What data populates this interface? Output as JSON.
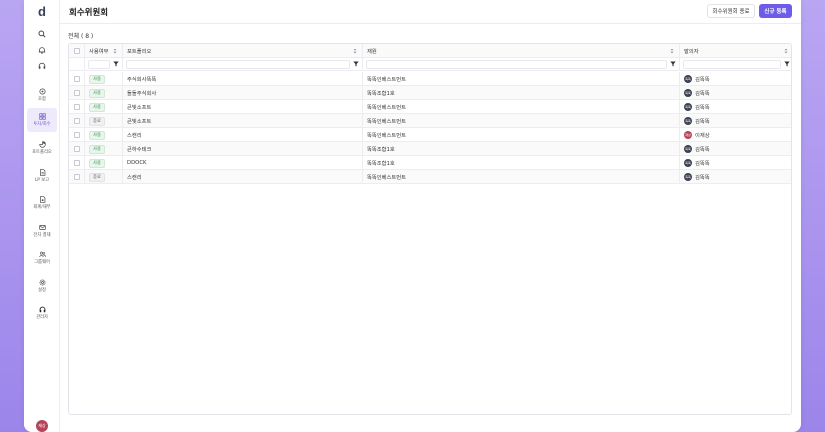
{
  "app": {
    "logo_text": "d",
    "title": "회수위원회",
    "colors": {
      "accent": "#6c5ce7",
      "active_nav_bg": "#eeeafc",
      "badge_green": "#3b8a50"
    }
  },
  "sidebar": {
    "top_icons": [
      "search-icon",
      "bell-icon",
      "headset-icon"
    ],
    "items": [
      {
        "label": "조합",
        "icon": "fund-icon",
        "active": false
      },
      {
        "label": "투자/회수",
        "icon": "grid-icon",
        "active": true
      },
      {
        "label": "포트폴리오",
        "icon": "pie-icon",
        "active": false
      },
      {
        "label": "LP 보고",
        "icon": "document-icon",
        "active": false
      },
      {
        "label": "회계/재무",
        "icon": "ledger-icon",
        "active": false
      },
      {
        "label": "전자 결재",
        "icon": "mail-icon",
        "active": false
      },
      {
        "label": "그룹웨어",
        "icon": "users-icon",
        "active": false
      },
      {
        "label": "설정",
        "icon": "gear-icon",
        "active": false
      },
      {
        "label": "관리자",
        "icon": "admin-icon",
        "active": false
      }
    ],
    "user_initials": "재상"
  },
  "header": {
    "close_button": "회수위원회 종료",
    "new_button": "신규 등록"
  },
  "total_label": "전체 ( 8 )",
  "table": {
    "columns": [
      "사용여부",
      "포트폴리오",
      "재원",
      "발의자"
    ],
    "rows": [
      {
        "status": "사용",
        "status_type": "use",
        "portfolio": "주식회사똑똑",
        "fund": "똑똑인베스트먼트",
        "proposer": "김똑똑",
        "avatar": "똑똑"
      },
      {
        "status": "사용",
        "status_type": "use",
        "portfolio": "돌돌주식회사",
        "fund": "똑똑조합1호",
        "proposer": "김똑똑",
        "avatar": "똑똑"
      },
      {
        "status": "사용",
        "status_type": "use",
        "portfolio": "큰빛소프트",
        "fund": "똑똑인베스트먼트",
        "proposer": "김똑똑",
        "avatar": "똑똑"
      },
      {
        "status": "종료",
        "status_type": "end",
        "portfolio": "큰빛소프트",
        "fund": "똑똑인베스트먼트",
        "proposer": "김똑똑",
        "avatar": "똑똑"
      },
      {
        "status": "사용",
        "status_type": "use",
        "portfolio": "스캔리",
        "fund": "똑똑인베스트먼트",
        "proposer": "이재상",
        "avatar": "재상"
      },
      {
        "status": "사용",
        "status_type": "use",
        "portfolio": "큰하수테크",
        "fund": "똑똑조합1호",
        "proposer": "김똑똑",
        "avatar": "똑똑"
      },
      {
        "status": "사용",
        "status_type": "use",
        "portfolio": "DDOCK",
        "fund": "똑똑조합1호",
        "proposer": "김똑똑",
        "avatar": "똑똑"
      },
      {
        "status": "종료",
        "status_type": "end",
        "portfolio": "스캔리",
        "fund": "똑똑인베스트먼트",
        "proposer": "김똑똑",
        "avatar": "똑똑"
      }
    ]
  }
}
